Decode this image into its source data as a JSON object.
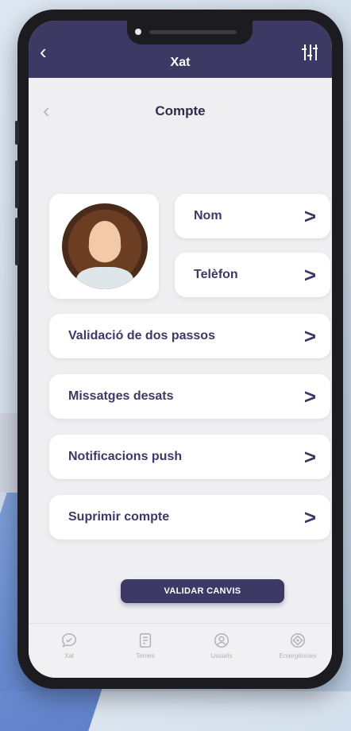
{
  "appbar": {
    "title": "Xat",
    "back_icon": "chevron-left-icon",
    "filter_icon": "sliders-icon"
  },
  "page": {
    "title": "Compte",
    "back_icon": "chevron-left-icon"
  },
  "profile": {
    "avatar": "profile-photo",
    "name_label": "Nom",
    "phone_label": "Telèfon"
  },
  "settings": [
    {
      "label": "Validació de dos passos"
    },
    {
      "label": "Missatges desats"
    },
    {
      "label": "Notificacions push"
    },
    {
      "label": "Suprimir compte"
    }
  ],
  "chevron": ">",
  "actions": {
    "validate_label": "VALIDAR CANVIS"
  },
  "tabbar": [
    {
      "label": "Xat",
      "icon": "chat-icon"
    },
    {
      "label": "Temes",
      "icon": "document-icon"
    },
    {
      "label": "Usuaris",
      "icon": "user-icon"
    },
    {
      "label": "Emergències",
      "icon": "emergency-icon"
    }
  ],
  "colors": {
    "primary": "#3d3965",
    "background": "#efeff1",
    "card": "#ffffff"
  }
}
